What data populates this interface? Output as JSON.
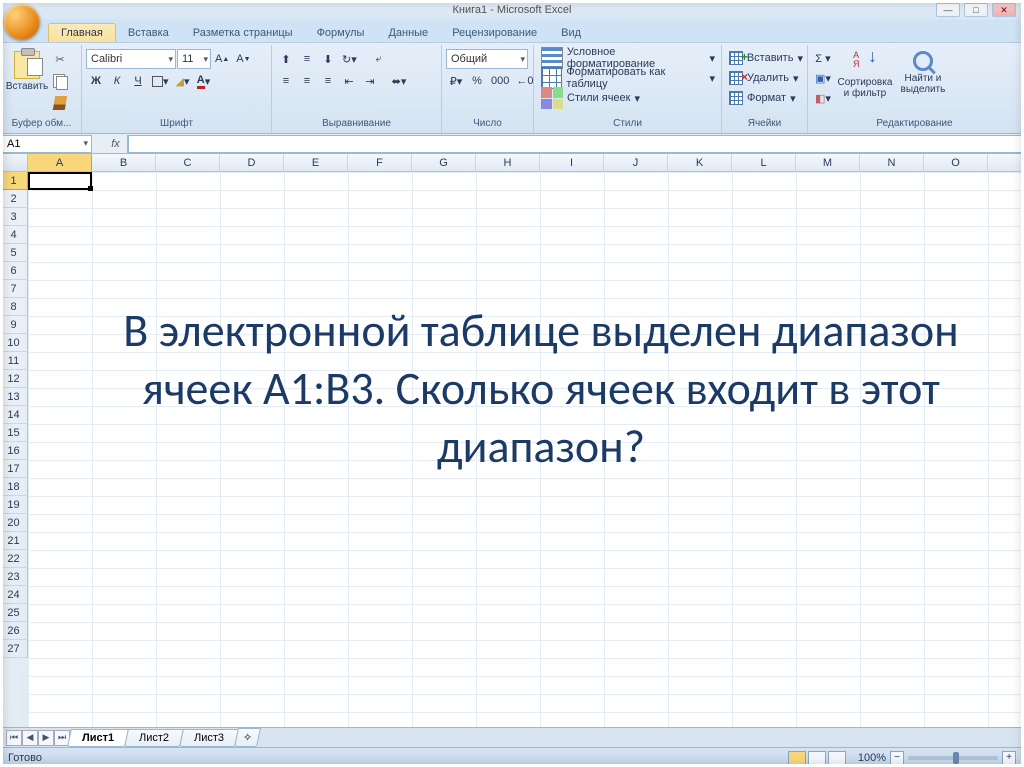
{
  "title": "Книга1 - Microsoft Excel",
  "tabs": {
    "home": "Главная",
    "insert": "Вставка",
    "layout": "Разметка страницы",
    "formulas": "Формулы",
    "data": "Данные",
    "review": "Рецензирование",
    "view": "Вид"
  },
  "ribbon": {
    "clipboard": {
      "label": "Буфер обм...",
      "paste": "Вставить"
    },
    "font": {
      "label": "Шрифт",
      "family": "Calibri",
      "size": "11",
      "bold": "Ж",
      "italic": "К",
      "underline": "Ч"
    },
    "alignment": {
      "label": "Выравнивание"
    },
    "number": {
      "label": "Число",
      "format": "Общий"
    },
    "styles": {
      "label": "Стили",
      "conditional": "Условное форматирование",
      "format_table": "Форматировать как таблицу",
      "cell_styles": "Стили ячеек"
    },
    "cells": {
      "label": "Ячейки",
      "insert": "Вставить",
      "delete": "Удалить",
      "format": "Формат"
    },
    "editing": {
      "label": "Редактирование",
      "sort": "Сортировка и фильтр",
      "find": "Найти и выделить"
    }
  },
  "namebox": "A1",
  "fx": "fx",
  "columns": [
    "A",
    "B",
    "C",
    "D",
    "E",
    "F",
    "G",
    "H",
    "I",
    "J",
    "K",
    "L",
    "M",
    "N",
    "O"
  ],
  "rows": [
    "1",
    "2",
    "3",
    "4",
    "5",
    "6",
    "7",
    "8",
    "9",
    "10",
    "11",
    "12",
    "13",
    "14",
    "15",
    "16",
    "17",
    "18",
    "19",
    "20",
    "21",
    "22",
    "23",
    "24",
    "25",
    "26",
    "27"
  ],
  "overlay": "В электронной таблице выделен диапазон ячеек А1:В3. Сколько ячеек входит в этот диапазон?",
  "sheets": {
    "s1": "Лист1",
    "s2": "Лист2",
    "s3": "Лист3"
  },
  "status": {
    "ready": "Готово",
    "zoom": "100%"
  }
}
